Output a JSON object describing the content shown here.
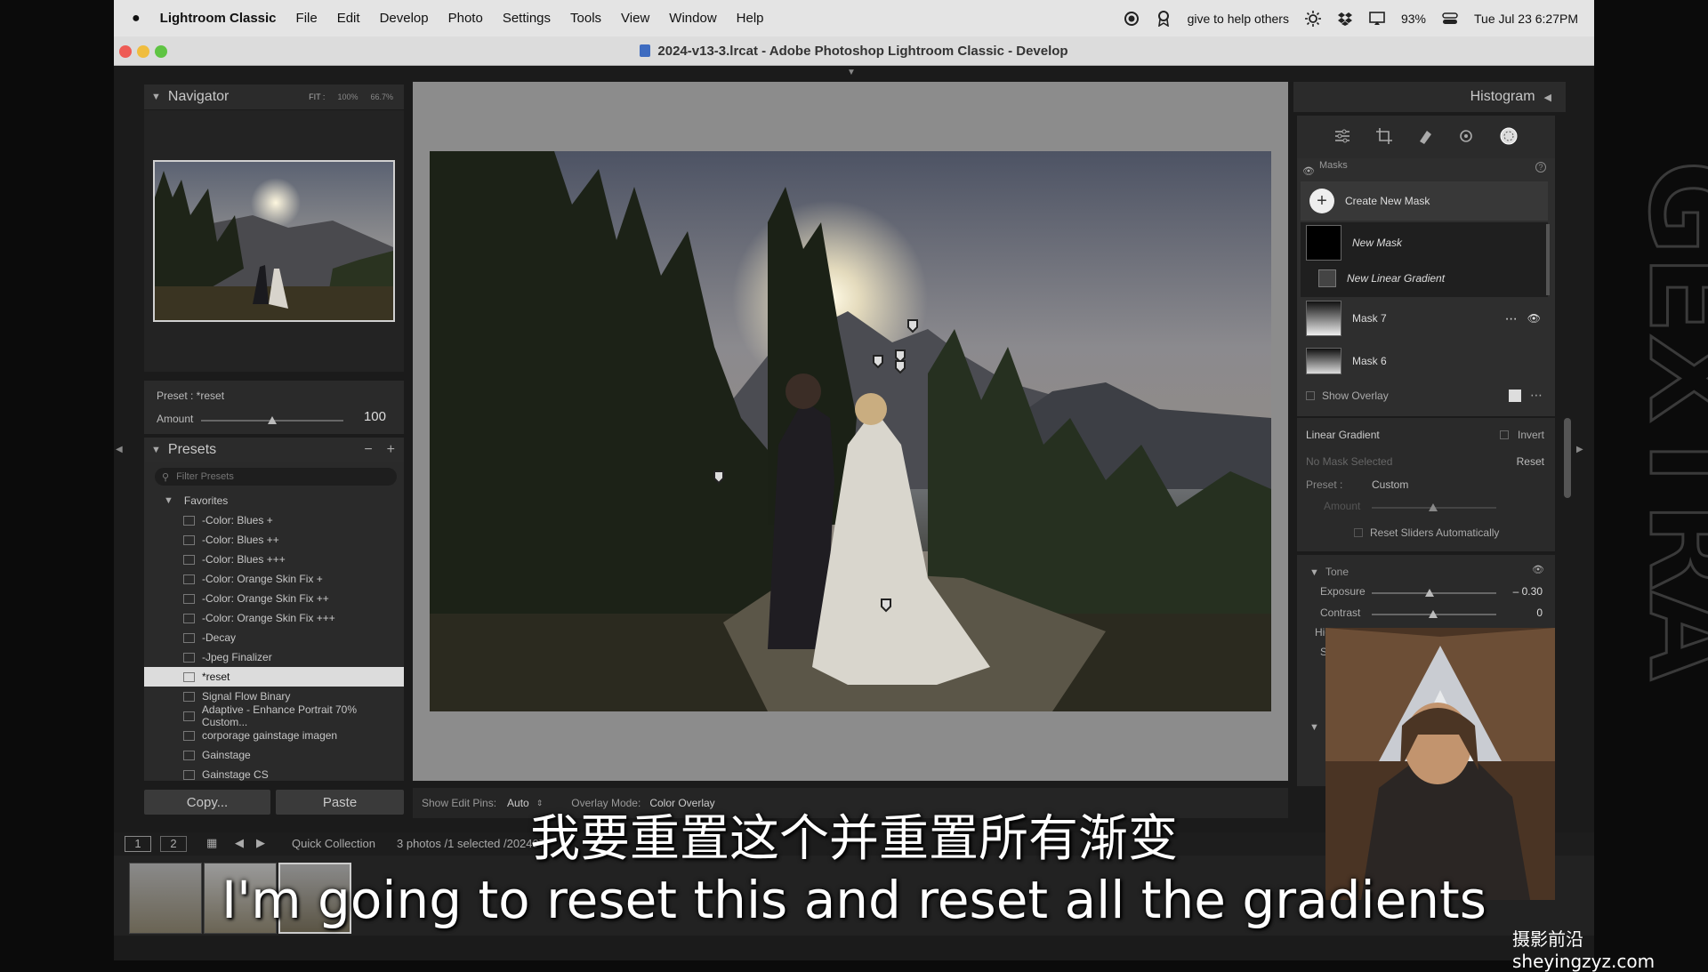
{
  "menubar": {
    "app_name": "Lightroom Classic",
    "items": [
      "File",
      "Edit",
      "Develop",
      "Photo",
      "Settings",
      "Tools",
      "View",
      "Window",
      "Help"
    ],
    "status_text": "give to help others",
    "battery": "93%",
    "datetime": "Tue Jul 23  6:27PM"
  },
  "window": {
    "title": "2024-v13-3.lrcat - Adobe Photoshop Lightroom Classic - Develop"
  },
  "navigator": {
    "title": "Navigator",
    "zoom_fit": "FIT :",
    "zoom_100": "100%",
    "zoom_other": "66.7%"
  },
  "preset_info": {
    "preset_label": "Preset : *reset",
    "amount_label": "Amount",
    "amount_value": "100",
    "amount_fraction": 0.5
  },
  "presets": {
    "title": "Presets",
    "minus": "−",
    "plus": "+",
    "search_placeholder": "Filter Presets",
    "group": "Favorites",
    "items": [
      "-Color: Blues +",
      "-Color: Blues ++",
      "-Color: Blues +++",
      "-Color: Orange Skin Fix +",
      "-Color: Orange Skin Fix ++",
      "-Color: Orange Skin Fix +++",
      "-Decay",
      "-Jpeg Finalizer",
      "*reset",
      "Signal Flow Binary",
      "Adaptive - Enhance Portrait 70% Custom...",
      "corporage gainstage imagen",
      "Gainstage",
      "Gainstage CS"
    ],
    "selected_index": 8
  },
  "left_buttons": {
    "copy": "Copy...",
    "paste": "Paste"
  },
  "center_toolbar": {
    "edit_pins_label": "Show Edit Pins:",
    "edit_pins_value": "Auto",
    "overlay_label": "Overlay Mode:",
    "overlay_value": "Color Overlay"
  },
  "right_panel": {
    "histogram": "Histogram",
    "masks_title": "Masks",
    "create_new_mask": "Create New Mask",
    "new_mask": "New Mask",
    "new_linear_gradient": "New Linear Gradient",
    "mask7": "Mask 7",
    "mask6": "Mask 6",
    "show_overlay": "Show Overlay",
    "linear_gradient": "Linear Gradient",
    "invert": "Invert",
    "no_mask_selected": "No Mask Selected",
    "reset": "Reset",
    "preset_label": "Preset :",
    "preset_value": "Custom",
    "amount_label": "Amount",
    "reset_sliders": "Reset Sliders Automatically",
    "tone": "Tone",
    "exposure_label": "Exposure",
    "exposure_value": "– 0.30",
    "contrast_label": "Contrast",
    "contrast_value": "0",
    "highlights_label": "Highlights",
    "shadows_label": "S"
  },
  "filmstrip": {
    "page1": "1",
    "page2": "2",
    "source": "Quick Collection",
    "count": "3 photos /1 selected /202407"
  },
  "subtitles": {
    "chinese": "我要重置这个并重置所有渐变",
    "english": "I'm going to reset this and reset all the gradients"
  },
  "watermark": "摄影前沿 sheyingzyz.com",
  "side_logo": "GEXTRA",
  "colors": {
    "accent": "#dcdcdc",
    "panel": "#2b2b2b",
    "canvas": "#8c8c8c"
  }
}
